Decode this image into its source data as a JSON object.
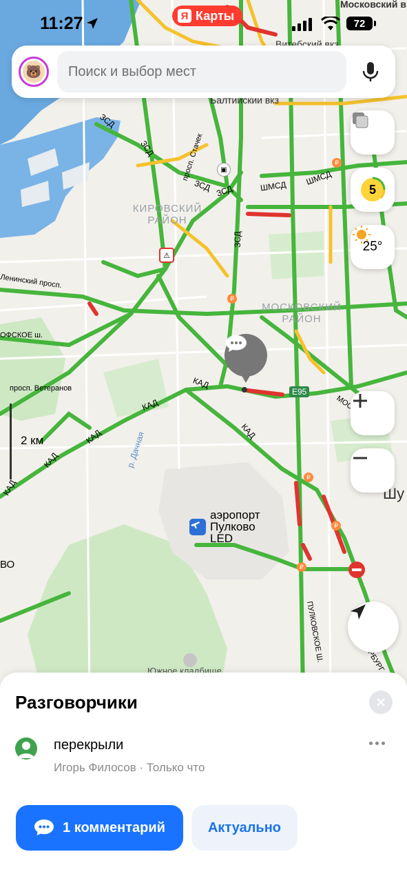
{
  "status_bar": {
    "time": "11:27",
    "brand_badge": "Карты",
    "brand_badge_letter": "Я",
    "battery": "72"
  },
  "search": {
    "placeholder": "Поиск и выбор мест"
  },
  "map_controls": {
    "traffic_level": "5",
    "temperature": "25°"
  },
  "scale": {
    "label": "2 км"
  },
  "map_labels": {
    "moskovsky_vokzal": "Московский в",
    "vitebsky_vokzal": "Витебский вкз",
    "baltiysky_vokzal": "Балтийский вкз",
    "zsd_1": "ЗСД",
    "zsd_2": "ЗСД",
    "zsd_3": "ЗСД",
    "zsd_4": "ЗСД",
    "zsd_vertical": "ЗСД",
    "shmsd_1": "ШМСД",
    "shmsd_2": "ШМСД",
    "stachek": "просп. Стачек",
    "leninsky": "Ленинский просп.",
    "krasnoselskoe": "ОФСКОЕ ш.",
    "veteranov": "просп. Ветеранов",
    "kad_1": "КАД",
    "kad_2": "КАД",
    "kad_3": "КАД",
    "kad_4": "КАД",
    "kad_5": "КАД",
    "kad_6": "КАД",
    "moskovskoe": "МОСКО",
    "e95": "E95",
    "dachnaya": "р. Дачная",
    "pulkovskoe": "ПУЛКОВСКОЕ Ш.",
    "peterburgskoe": "ПЕТЕРБУРГ",
    "shu": "Шу",
    "vo": "ВО",
    "yuzhnoe": "Южное кладбище"
  },
  "districts": {
    "kirovsky": "КИРОВСКИЙ РАЙОН",
    "moskovsky": "МОСКОВСКИЙ РАЙОН"
  },
  "airport": {
    "name": "аэропорт Пулково LED"
  },
  "sheet": {
    "title": "Разговорчики",
    "comment": "перекрыли",
    "meta": "Игорь Филосов · Только что",
    "comments_button": "1 комментарий",
    "relevant_button": "Актуально"
  },
  "colors": {
    "accent": "#1a73ff",
    "traffic_green": "#46b53c",
    "traffic_yellow": "#f5c22c",
    "traffic_red": "#e0342e",
    "water": "#6aa9e0"
  }
}
